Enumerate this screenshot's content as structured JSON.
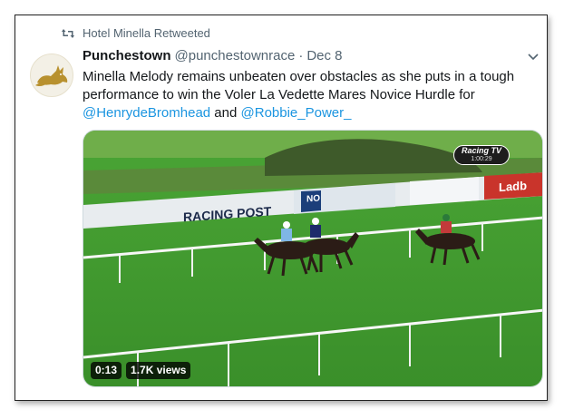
{
  "retweet_banner": {
    "label": "Hotel Minella Retweeted",
    "icon": "retweet-icon"
  },
  "tweet": {
    "author_name": "Punchestown",
    "author_handle": "@punchestownrace",
    "separator": "·",
    "date": "Dec 8",
    "avatar_icon": "fox-logo",
    "menu_icon": "chevron-down-icon",
    "text_part1": "Minella Melody remains unbeaten over obstacles as she puts in a tough performance to win the Voler La Vedette Mares Novice Hurdle for ",
    "mention1": "@HenrydeBromhead",
    "text_part2": " and ",
    "mention2": "@Robbie_Power_"
  },
  "media": {
    "duration": "0:13",
    "views": "1.7K views",
    "overlay_logo": "Racing TV",
    "overlay_clock": "1:00:29",
    "hoardings": {
      "racing_post": "RACING POST",
      "sponsor_mid": "NO",
      "sponsor_right": "Ladb"
    }
  },
  "colors": {
    "link": "#1b95e0",
    "secondary_text": "#536471",
    "turf": "#3f9a2e",
    "brand_gold": "#b8912f"
  }
}
